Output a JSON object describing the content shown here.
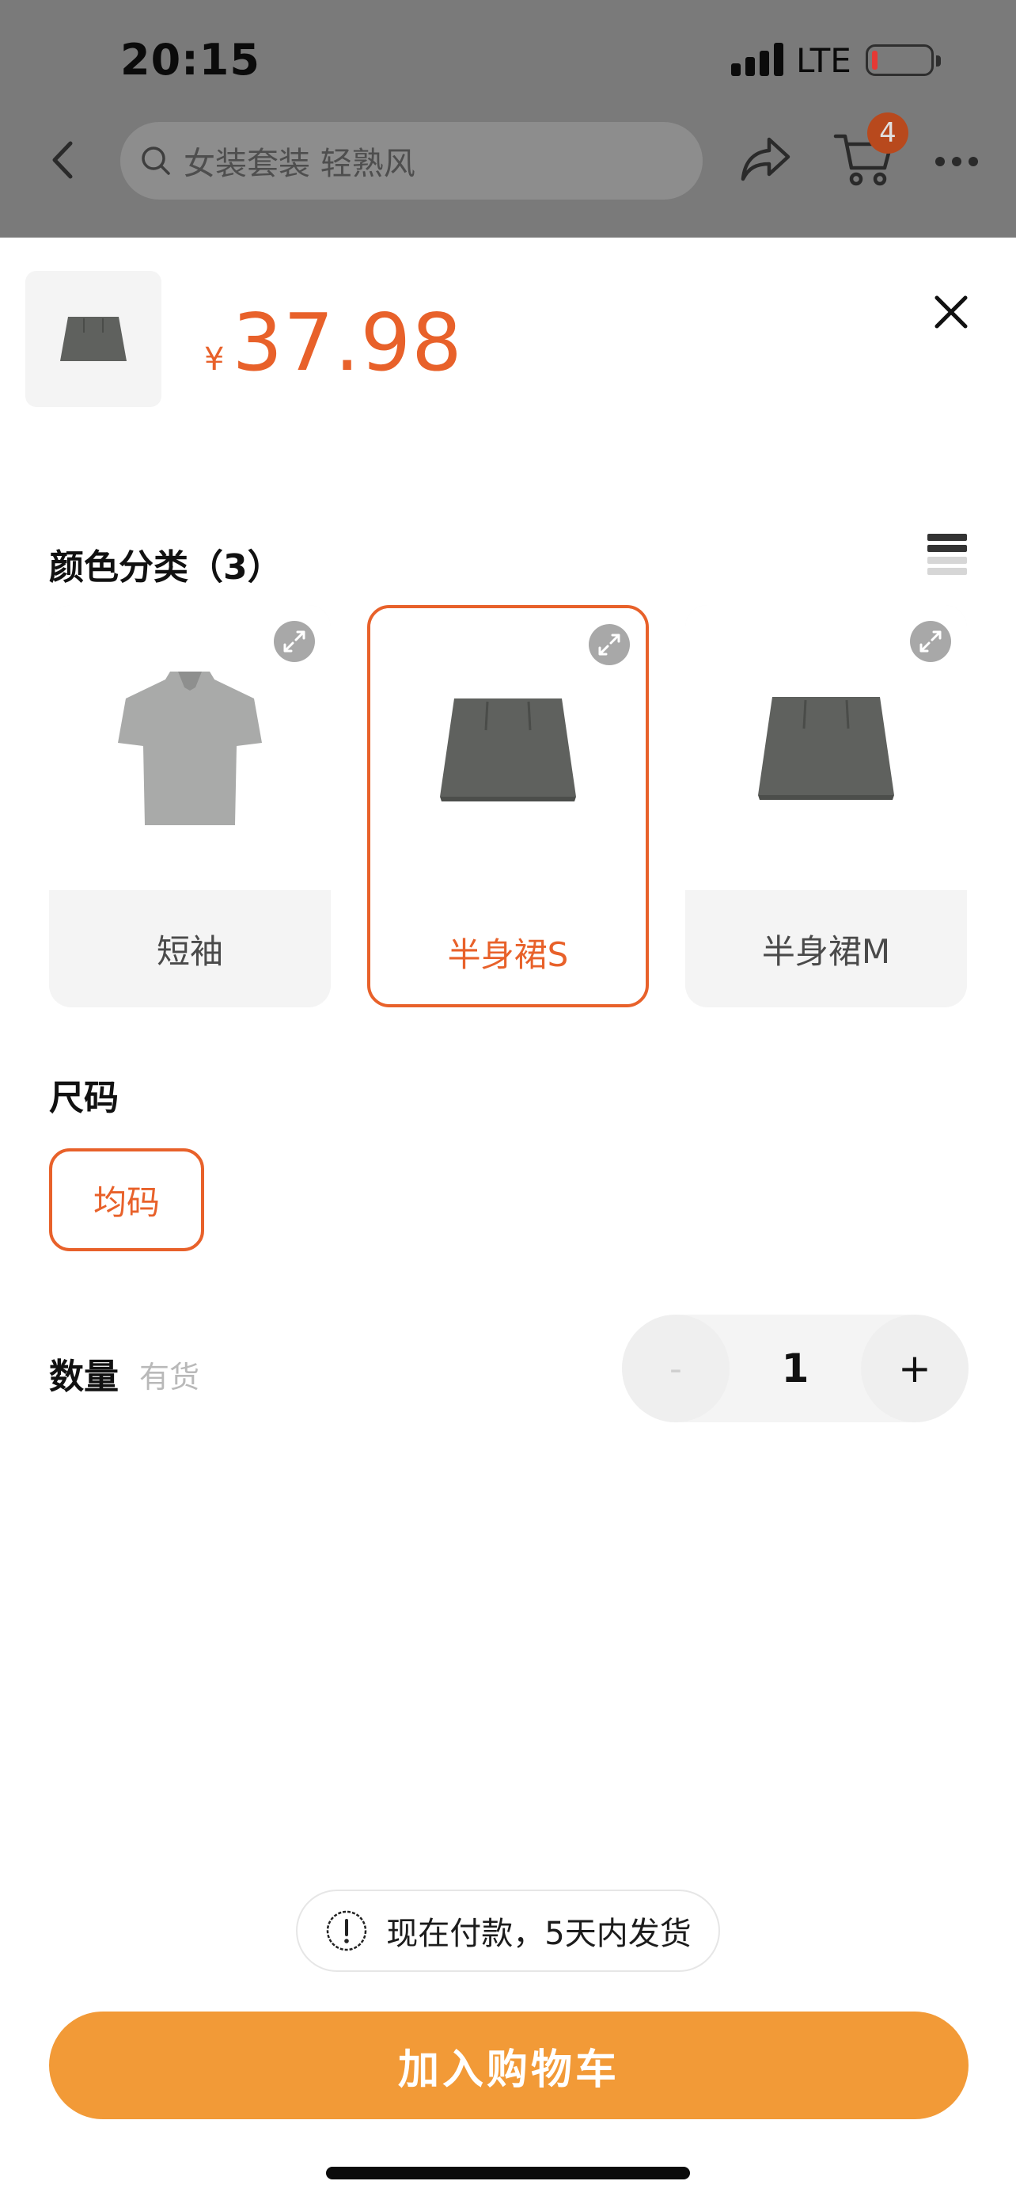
{
  "status_bar": {
    "time": "20:15",
    "network": "LTE"
  },
  "nav": {
    "search_placeholder": "女装套装 轻熟风",
    "cart_badge": "4"
  },
  "product": {
    "currency": "¥",
    "price": "37.98"
  },
  "color_section": {
    "title": "颜色分类（3）",
    "variants": [
      {
        "label": "短袖",
        "selected": false
      },
      {
        "label": "半身裙S",
        "selected": true
      },
      {
        "label": "半身裙M",
        "selected": false
      }
    ]
  },
  "size_section": {
    "title": "尺码",
    "options": [
      {
        "label": "均码",
        "selected": true
      }
    ]
  },
  "quantity": {
    "title": "数量",
    "stock": "有货",
    "minus": "-",
    "value": "1",
    "plus": "+"
  },
  "shipping_note": "现在付款，5天内发货",
  "add_to_cart": "加入购物车",
  "colors": {
    "accent": "#e8612a",
    "button": "#f29a37",
    "dim_overlay": "#7a7a7a"
  }
}
